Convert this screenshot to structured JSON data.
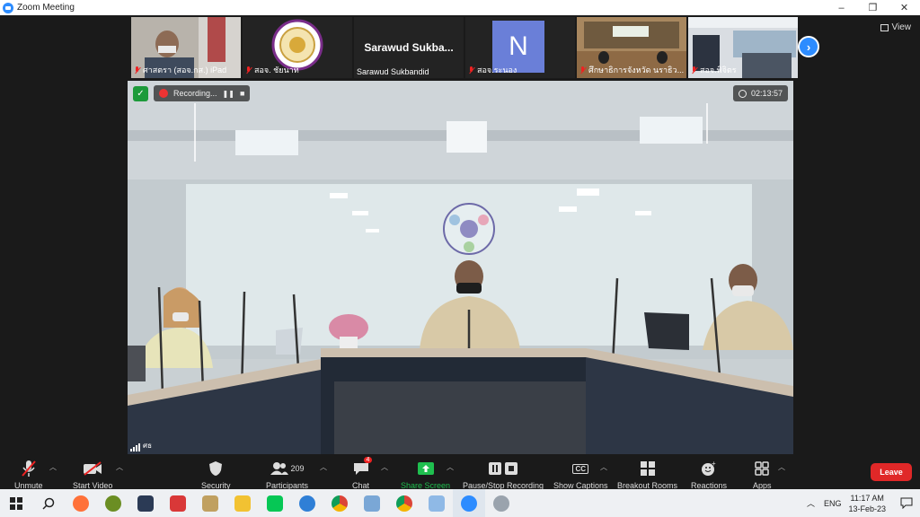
{
  "window": {
    "title": "Zoom Meeting",
    "controls": [
      "–",
      "❐",
      "✕"
    ]
  },
  "participants_strip": [
    {
      "name": "ศาสตรา (สอจ.กส.) iPad",
      "type": "camera",
      "muted": true
    },
    {
      "name": "สอจ. ชัยนาท",
      "type": "logo",
      "muted": true
    },
    {
      "name": "Sarawud Sukbandid",
      "display_name": "Sarawud  Sukba...",
      "type": "name",
      "muted": false
    },
    {
      "name": "สอจ.ระนอง",
      "type": "avatar",
      "avatar_letter": "N",
      "avatar_color": "#6a7fd8",
      "muted": true
    },
    {
      "name": "ศึกษาธิการจังหวัด นราธิว...",
      "type": "camera",
      "muted": true
    },
    {
      "name": "สอจ.พิจิตร",
      "type": "camera",
      "muted": true
    }
  ],
  "view_button": "View",
  "recording": {
    "label": "Recording...",
    "pause": "❚❚",
    "stop": "■"
  },
  "meeting_timer": "02:13:57",
  "active_speaker": "ศธ",
  "toolbar": {
    "unmute": "Unmute",
    "start_video": "Start Video",
    "security": "Security",
    "participants": "Participants",
    "participants_count": "209",
    "chat": "Chat",
    "chat_badge": "4",
    "share_screen": "Share Screen",
    "pause_stop_recording": "Pause/Stop Recording",
    "show_captions": "Show Captions",
    "captions_icon_text": "CC",
    "breakout_rooms": "Breakout Rooms",
    "reactions": "Reactions",
    "apps": "Apps",
    "leave": "Leave"
  },
  "taskbar": {
    "apps": [
      "windows-start",
      "search",
      "firefox",
      "snail-app",
      "file-app",
      "vivaldi",
      "photo-app",
      "file-explorer",
      "line",
      "edge-like",
      "chrome",
      "notepad-app",
      "chrome-alt",
      "paint-app",
      "zoom",
      "settings-app"
    ],
    "language": "ENG",
    "time": "11:17 AM",
    "date": "13-Feb-23"
  },
  "colors": {
    "zoom_blue": "#2d8cff",
    "share_green": "#1fbf4f",
    "leave_red": "#e02828",
    "mute_red": "#e22222"
  }
}
